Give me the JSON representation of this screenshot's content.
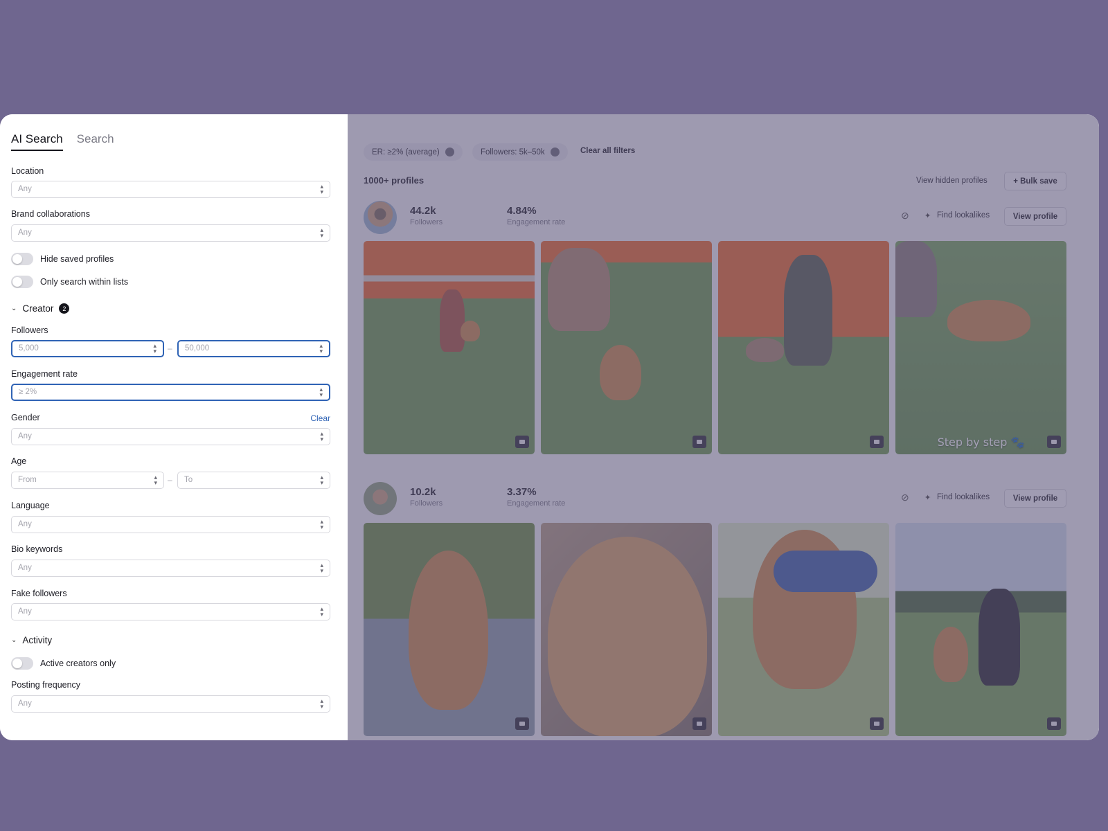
{
  "tabs": [
    {
      "label": "AI Search",
      "active": true
    },
    {
      "label": "Search",
      "active": false
    }
  ],
  "filters": {
    "location": {
      "label": "Location",
      "placeholder": "Any"
    },
    "brand_collaborations": {
      "label": "Brand collaborations",
      "placeholder": "Any"
    },
    "hide_saved": {
      "label": "Hide saved profiles",
      "on": false
    },
    "only_lists": {
      "label": "Only search within lists",
      "on": false
    },
    "creator_section": {
      "label": "Creator",
      "count": "2"
    },
    "followers": {
      "label": "Followers",
      "min": "5,000",
      "max": "50,000",
      "separator": "–"
    },
    "engagement_rate": {
      "label": "Engagement rate",
      "value": "≥ 2%"
    },
    "gender": {
      "label": "Gender",
      "placeholder": "Any",
      "clear_label": "Clear"
    },
    "age": {
      "label": "Age",
      "from": "From",
      "to": "To",
      "separator": "–"
    },
    "language": {
      "label": "Language",
      "placeholder": "Any"
    },
    "bio_keywords": {
      "label": "Bio keywords",
      "placeholder": "Any"
    },
    "fake_followers": {
      "label": "Fake followers",
      "placeholder": "Any"
    },
    "activity_section": {
      "label": "Activity"
    },
    "active_only": {
      "label": "Active creators only",
      "on": false
    },
    "posting_frequency": {
      "label": "Posting frequency",
      "placeholder": "Any"
    }
  },
  "results": {
    "chips": [
      {
        "label": "ER: ≥2% (average)"
      },
      {
        "label": "Followers: 5k–50k"
      }
    ],
    "clear_all": "Clear all filters",
    "count_label": "1000+ profiles",
    "view_hidden": "View hidden profiles",
    "bulk_save": "+ Bulk save",
    "profiles": [
      {
        "followers": "44.2k",
        "followers_label": "Followers",
        "engagement": "4.84%",
        "engagement_label": "Engagement rate",
        "find_lookalikes": "Find lookalikes",
        "view_profile": "View profile",
        "post_overlay": "Step by step 🐾"
      },
      {
        "followers": "10.2k",
        "followers_label": "Followers",
        "engagement": "3.37%",
        "engagement_label": "Engagement rate",
        "find_lookalikes": "Find lookalikes",
        "view_profile": "View profile"
      }
    ]
  },
  "icons": {
    "hide": "eye-off-icon",
    "sparkle": "sparkle-icon",
    "video": "video-icon",
    "select_arrows": "updown-chevron-icon",
    "chevron": "chevron-down-icon"
  },
  "colors": {
    "backdrop": "#6f668f",
    "accent_focus": "#2f63b5",
    "link": "#2f63b5"
  }
}
